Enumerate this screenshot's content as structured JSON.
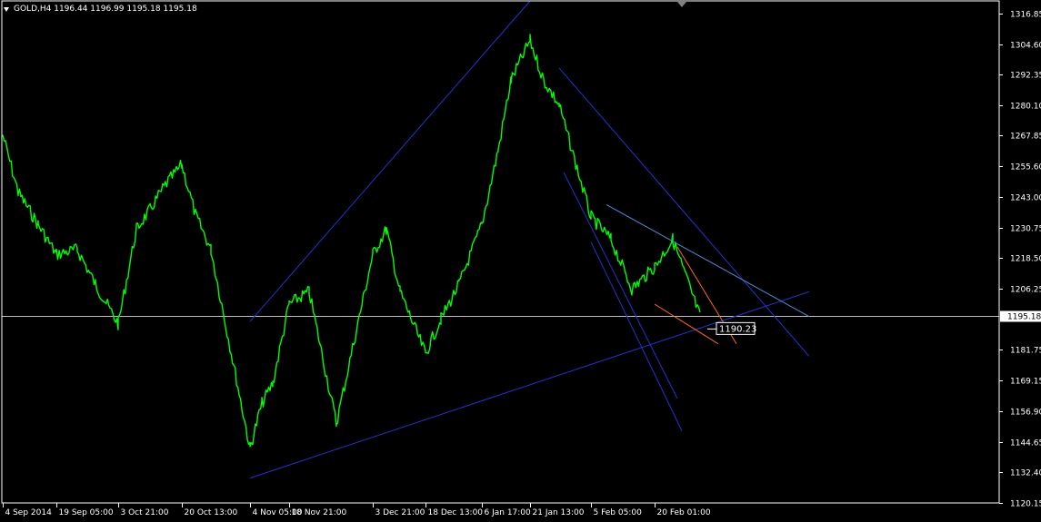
{
  "header": {
    "title": "GOLD,H4  1196.44 1196.99 1195.18 1195.18"
  },
  "chart_data": {
    "type": "line",
    "symbol": "GOLD",
    "timeframe": "H4",
    "ylim": [
      1120.0,
      1322.0
    ],
    "y_ticks": [
      "1316.85",
      "1304.60",
      "1292.35",
      "1280.10",
      "1267.85",
      "1255.60",
      "1243.00",
      "1230.75",
      "1218.50",
      "1206.25",
      "1181.75",
      "1169.15",
      "1156.90",
      "1144.65",
      "1132.40",
      "1120.15"
    ],
    "x_ticks": [
      "4 Sep 2014",
      "19 Sep 05:00",
      "3 Oct 21:00",
      "20 Oct 13:00",
      "4 Nov 05:00",
      "18 Nov 21:00",
      "3 Dec 21:00",
      "18 Dec 13:00",
      "6 Jan 17:00",
      "21 Jan 13:00",
      "5 Feb 05:00",
      "20 Feb 01:00"
    ],
    "bid_price": 1195.18,
    "bid_label": "1195.18",
    "object_price_label": "1190.23",
    "series": [
      {
        "color": "#00ff00",
        "x": [
          "4 Sep 2014",
          "9 Sep",
          "14 Sep",
          "19 Sep 05:00",
          "24 Sep",
          "28 Sep",
          "3 Oct 21:00",
          "8 Oct",
          "13 Oct",
          "17 Oct",
          "20 Oct 13:00",
          "25 Oct",
          "29 Oct",
          "4 Nov 05:00",
          "8 Nov",
          "12 Nov",
          "18 Nov 21:00",
          "21 Nov",
          "24 Nov",
          "3 Dec 21:00",
          "8 Dec",
          "12 Dec",
          "18 Dec 13:00",
          "23 Dec",
          "29 Dec",
          "6 Jan 17:00",
          "11 Jan",
          "16 Jan",
          "21 Jan 13:00",
          "25 Jan",
          "29 Jan",
          "5 Feb 05:00",
          "9 Feb",
          "14 Feb",
          "20 Feb 01:00",
          "24 Feb",
          "27 Feb"
        ],
        "close": [
          1268,
          1245,
          1232,
          1220,
          1222,
          1208,
          1192,
          1230,
          1238,
          1248,
          1256,
          1236,
          1222,
          1142,
          1160,
          1168,
          1200,
          1205,
          1152,
          1220,
          1230,
          1205,
          1180,
          1194,
          1208,
          1232,
          1262,
          1290,
          1306,
          1290,
          1280,
          1235,
          1226,
          1206,
          1215,
          1226,
          1195
        ]
      }
    ],
    "trendlines": [
      {
        "name": "rising-channel-top",
        "color": "#2233cc",
        "points": [
          [
            "4 Nov 05:00",
            1193
          ],
          [
            "21 Jan 13:00",
            1322
          ]
        ]
      },
      {
        "name": "support-line",
        "color": "#2233cc",
        "points": [
          [
            "4 Nov 05:00",
            1130
          ],
          [
            "5 Mar",
            1205
          ]
        ]
      },
      {
        "name": "falling-channel-1",
        "color": "#2233cc",
        "points": [
          [
            "29 Jan",
            1295
          ],
          [
            "5 Mar",
            1179
          ]
        ]
      },
      {
        "name": "falling-channel-2",
        "color": "#2233cc",
        "points": [
          [
            "1 Feb",
            1253
          ],
          [
            "25 Feb",
            1162
          ]
        ]
      },
      {
        "name": "falling-channel-3",
        "color": "#2233cc",
        "points": [
          [
            "5 Feb 05:00",
            1225
          ],
          [
            "23 Feb",
            1149
          ]
        ]
      },
      {
        "name": "resistance-line",
        "color": "#4a8fd6",
        "points": [
          [
            "8 Feb",
            1240
          ],
          [
            "5 Mar",
            1195
          ]
        ]
      },
      {
        "name": "small-channel-upper",
        "color": "#ff6a1a",
        "points": [
          [
            "25 Feb",
            1223
          ],
          [
            "1 Mar",
            1184
          ]
        ]
      },
      {
        "name": "small-channel-lower",
        "color": "#ff6a1a",
        "points": [
          [
            "20 Feb 01:00",
            1200
          ],
          [
            "28 Feb",
            1184
          ]
        ]
      }
    ]
  }
}
